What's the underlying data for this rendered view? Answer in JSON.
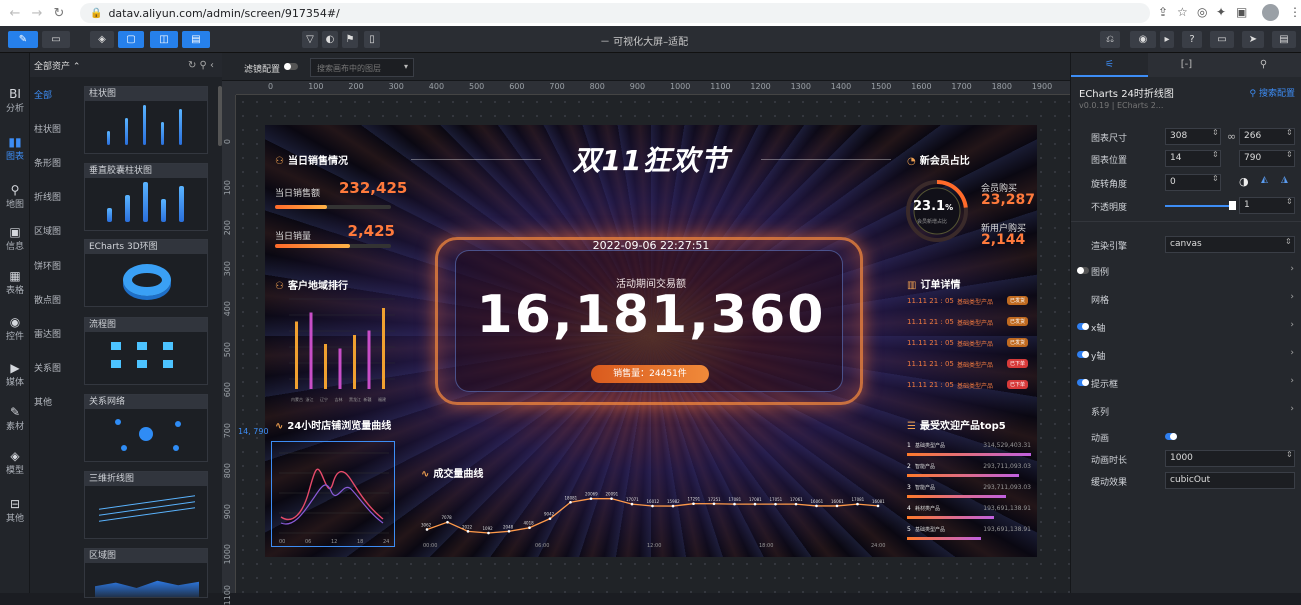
{
  "browser": {
    "url": "datav.aliyun.com/admin/screen/917354#/"
  },
  "toolbar": {
    "title": "－ 可视化大屏–适配"
  },
  "rail": [
    {
      "label": "分析",
      "icon": "BI"
    },
    {
      "label": "图表",
      "icon": "▮▮"
    },
    {
      "label": "地图",
      "icon": "⚲"
    },
    {
      "label": "信息",
      "icon": "▣"
    },
    {
      "label": "表格",
      "icon": "▦"
    },
    {
      "label": "控件",
      "icon": "◉"
    },
    {
      "label": "媒体",
      "icon": "▶"
    },
    {
      "label": "素材",
      "icon": "✎"
    },
    {
      "label": "模型",
      "icon": "◈"
    },
    {
      "label": "其他",
      "icon": "⊟"
    }
  ],
  "assets": {
    "header": "全部资产 ⌃",
    "categories": [
      "全部",
      "柱状图",
      "条形图",
      "折线图",
      "区域图",
      "饼环图",
      "散点图",
      "雷达图",
      "关系图",
      "其他"
    ],
    "cards": [
      "柱状图",
      "垂直胶囊柱状图",
      "ECharts 3D环图",
      "流程图",
      "关系网络",
      "三维折线图",
      "区域图"
    ]
  },
  "canvasbar": {
    "filter_label": "滤镜配置",
    "search_placeholder": "搜索画布中的图层"
  },
  "ruler": {
    "x": [
      "0",
      "100",
      "200",
      "300",
      "400",
      "500",
      "600",
      "700",
      "800",
      "900",
      "1000",
      "1100",
      "1200",
      "1300",
      "1400",
      "1500",
      "1600",
      "1700",
      "1800",
      "1900"
    ],
    "y": [
      "0",
      "100",
      "200",
      "300",
      "400",
      "500",
      "600",
      "700",
      "800",
      "900",
      "1000",
      "1100"
    ],
    "coord": "14, 790"
  },
  "screen": {
    "title": "双11狂欢节",
    "sales_title": "当日销售情况",
    "sales_amount_label": "当日销售额",
    "sales_amount": "232,425",
    "sales_amount_progress": 0.45,
    "sales_qty_label": "当日销量",
    "sales_qty": "2,425",
    "sales_qty_progress": 0.65,
    "region_title": "客户地域排行",
    "region_chart": {
      "type": "bar",
      "categories": [
        "内蒙古",
        "浙江",
        "辽宁",
        "吉林",
        "黑龙江",
        "新疆",
        "福建"
      ],
      "values": [
        75,
        85,
        50,
        45,
        60,
        65,
        90
      ]
    },
    "hourly_title": "24小时店铺浏览量曲线",
    "hourly_chart": {
      "type": "line",
      "x": [
        "00",
        "06",
        "12",
        "18",
        "24"
      ]
    },
    "datetime": "2022-09-06 22:27:51",
    "gmv_label": "活动期间交易额",
    "gmv": "16,181,360",
    "sold_label": "销售量：24451件",
    "member_title": "新会员占比",
    "member_pct": "23.1",
    "member_pct_unit": "%",
    "member_sub": "会员新增占比",
    "member_buy_label": "会员购买",
    "member_buy": "23,287",
    "new_buy_label": "新用户购买",
    "new_buy": "2,144",
    "orders_title": "订单详情",
    "orders": [
      {
        "time": "11.11 21 : 05",
        "name": "基础类型产品",
        "tag": "已发货"
      },
      {
        "time": "11.11 21 : 05",
        "name": "基础类型产品",
        "tag": "已发货"
      },
      {
        "time": "11.11 21 : 05",
        "name": "基础类型产品",
        "tag": "已发货"
      },
      {
        "time": "11.11 21 : 05",
        "name": "基础类型产品",
        "tag": "已下单"
      },
      {
        "time": "11.11 21 : 05",
        "name": "基础类型产品",
        "tag": "已下单"
      }
    ],
    "top5_title": "最受欢迎产品top5",
    "top5": [
      {
        "rank": "1",
        "name": "基础类型产品",
        "value": "314,529,403.31"
      },
      {
        "rank": "2",
        "name": "智能产品",
        "value": "293,711,093.03"
      },
      {
        "rank": "3",
        "name": "智能产品",
        "value": "293,711,093.03"
      },
      {
        "rank": "4",
        "name": "耗材类产品",
        "value": "193,691,138.91"
      },
      {
        "rank": "5",
        "name": "基础类型产品",
        "value": "193,691,138.91"
      }
    ],
    "volume_title": "成交量曲线",
    "volume_chart": {
      "type": "line",
      "x": [
        "00:00",
        "06:00",
        "12:00",
        "18:00",
        "24:00"
      ],
      "labels": [
        "3062",
        "7078",
        "2022",
        "1092",
        "2048",
        "4018",
        "9042",
        "18081",
        "20069",
        "20091",
        "17071",
        "16012",
        "15982",
        "17291",
        "17251",
        "17081",
        "17081",
        "17051",
        "17061",
        "16061",
        "16061",
        "17081",
        "16081"
      ]
    }
  },
  "props": {
    "tabs": [
      "⚟",
      "[-]",
      "⚲"
    ],
    "title": "ECharts 24时折线图",
    "search": "⚲ 搜索配置",
    "version": "v0.0.19 | ECharts 2...",
    "size_label": "图表尺寸",
    "width": "308",
    "height": "266",
    "pos_label": "图表位置",
    "x": "14",
    "y": "790",
    "rot_label": "旋转角度",
    "rot": "0",
    "opacity_label": "不透明度",
    "opacity": "1",
    "engine_label": "渲染引擎",
    "engine": "canvas",
    "legend": "图例",
    "grid": "网格",
    "xaxis": "x轴",
    "yaxis": "y轴",
    "tooltip": "提示框",
    "series": "系列",
    "anim_label": "动画",
    "anim_dur_label": "动画时长",
    "anim_dur": "1000",
    "ease_label": "缓动效果",
    "ease": "cubicOut"
  }
}
